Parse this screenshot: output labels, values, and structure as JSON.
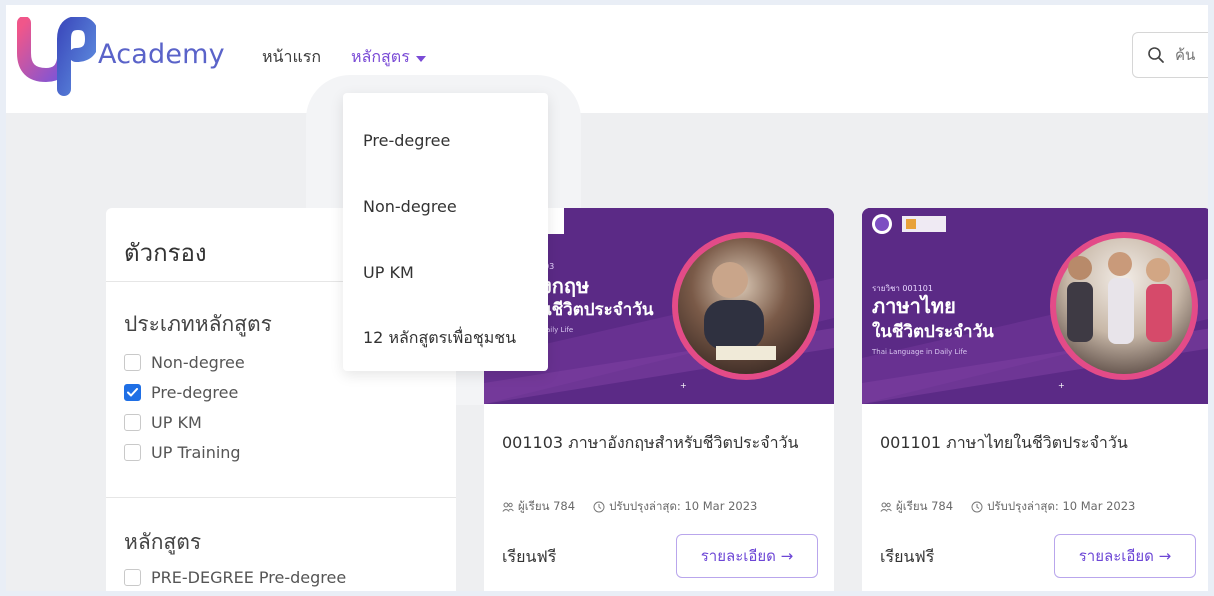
{
  "brand": {
    "name": "Academy"
  },
  "nav": {
    "home": "หน้าแรก",
    "courses": "หลักสูตร",
    "search_placeholder": "ค้น"
  },
  "dropdown": {
    "items": [
      "Pre-degree",
      "Non-degree",
      "UP KM",
      "12 หลักสูตรเพื่อชุมชน"
    ]
  },
  "filter": {
    "title": "ตัวกรอง",
    "type_section": "ประเภทหลักสูตร",
    "type_options": [
      {
        "label": "Non-degree",
        "checked": false
      },
      {
        "label": "Pre-degree",
        "checked": true
      },
      {
        "label": "UP KM",
        "checked": false
      },
      {
        "label": "UP Training",
        "checked": false
      }
    ],
    "course_section": "หลักสูตร",
    "course_options": [
      {
        "label": "PRE-DEGREE Pre-degree",
        "checked": false
      }
    ]
  },
  "courses": [
    {
      "banner_code": "03",
      "banner_title_1": "งกฤษ",
      "banner_title_2": "นชีวิตประจำวัน",
      "banner_en": "aily Life",
      "title": "001103 ภาษาอังกฤษสำหรับชีวิตประจำวัน",
      "students": "ผู้เรียน 784",
      "updated": "ปรับปรุงล่าสุด: 10 Mar 2023",
      "price": "เรียนฟรี",
      "detail": "รายละเอียด →"
    },
    {
      "banner_code": "รายวิชา 001101",
      "banner_title_1": "ภาษาไทย",
      "banner_title_2": "ในชีวิตประจำวัน",
      "banner_en": "Thai Language in Daily Life",
      "title": "001101 ภาษาไทยในชีวิตประจำวัน",
      "students": "ผู้เรียน 784",
      "updated": "ปรับปรุงล่าสุด: 10 Mar 2023",
      "price": "เรียนฟรี",
      "detail": "รายละเอียด →"
    }
  ],
  "colors": {
    "accent": "#6f4ce0",
    "banner": "#5b2a86",
    "logo_purple": "#5a63c9",
    "logo_pink": "#e64a8a",
    "checkbox": "#1f6fe5"
  }
}
